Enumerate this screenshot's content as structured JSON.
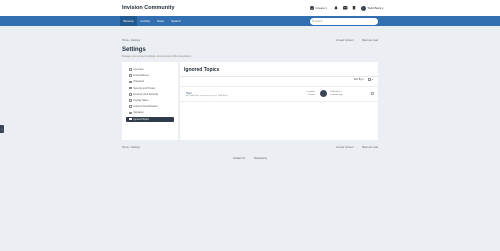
{
  "header": {
    "brand": "Invision Community",
    "create_label": "Create",
    "user_name": "Todd Beck"
  },
  "nav": {
    "links": [
      "Browse",
      "Activity",
      "Store",
      "Search"
    ]
  },
  "search": {
    "placeholder": "Search"
  },
  "breadcrumb": {
    "home": "Home",
    "sep": "›",
    "current": "Settings",
    "unread": "Unread Content",
    "mark_read": "Mark site read"
  },
  "page": {
    "title": "Settings",
    "subtitle": "Manage your account settings, devices and profile integrations"
  },
  "sidebar": {
    "items": [
      "Overview",
      "Email Address",
      "Password",
      "Security and Privacy",
      "Devices Used Recently",
      "Display Name",
      "Content View Behavior",
      "Signature",
      "Ignored Topics"
    ]
  },
  "main": {
    "heading": "Ignored Topics",
    "sort_label": "Sort By ▾",
    "topic": {
      "title": "Test",
      "meta": "By Todd Beck in Forums post or Todd Beck",
      "replies": "0 replies",
      "views": "2 views",
      "last_poster": "Todd Beck ✓",
      "last_time": "1 minute ago"
    }
  },
  "footer": {
    "contact": "Contact Us",
    "powered": "Powered by"
  }
}
